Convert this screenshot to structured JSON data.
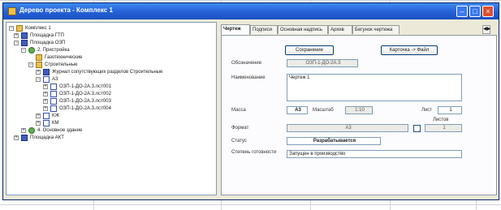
{
  "window": {
    "title": "Дерево проекта - Комплекс 1"
  },
  "tree": [
    {
      "label": "Комплекс 1",
      "icon": "folder-icon"
    },
    {
      "label": "Площадка ГТП",
      "icon": "building-icon"
    },
    {
      "label": "Площадка ОЗП",
      "icon": "building-icon"
    },
    {
      "label": "2. Пристройка",
      "icon": "structure-icon"
    },
    {
      "label": "Газотехнические",
      "icon": "folder-icon"
    },
    {
      "label": "Строительные",
      "icon": "folder-icon"
    },
    {
      "label": "Журнал сопутствующих разделов Строительные",
      "icon": "book-icon"
    },
    {
      "label": "АЗ",
      "icon": "set-icon"
    },
    {
      "label": "ОЗП-1-ДО-2А.3.лст001",
      "icon": "drawing-icon"
    },
    {
      "label": "ОЗП-1-ДО-2А.3.лст002",
      "icon": "drawing-icon"
    },
    {
      "label": "ОЗП-1-ДО-2А.3.лст003",
      "icon": "drawing-icon"
    },
    {
      "label": "ОЗП-1-ДО-2А.3.лст004",
      "icon": "drawing-icon"
    },
    {
      "label": "КЖ",
      "icon": "set-icon"
    },
    {
      "label": "КМ",
      "icon": "set-icon"
    },
    {
      "label": "4. Основное здание",
      "icon": "structure-icon"
    },
    {
      "label": "Площадка АКТ",
      "icon": "building-icon"
    }
  ],
  "tabs": [
    "Чертеж",
    "Подписи",
    "Основная надпись",
    "Архив",
    "Бегунок чертежа"
  ],
  "tab_scroll": "◀▶",
  "form": {
    "save_button": "Сохранение",
    "to_sheet_button": "Карточка -> Файл",
    "designation_label": "Обозначение",
    "designation_value": "ОЗП-1-ДО-2А.3",
    "name_label": "Наименование",
    "name_value": "Чертеж 1",
    "sheet_format_label": "Масса",
    "sheet_format_value": "А3",
    "scale_label": "Масштаб",
    "scale_value": "1:10",
    "sheet_label": "Лист",
    "sheet_value": "1",
    "sheets_label": "Листов",
    "sheets_value": "1",
    "format_label": "Формат",
    "format_value": "А3",
    "status_label": "Статус",
    "status_value": "Разрабатывается",
    "readiness_label": "Степень готовности",
    "readiness_value": "Запущен в производство"
  }
}
